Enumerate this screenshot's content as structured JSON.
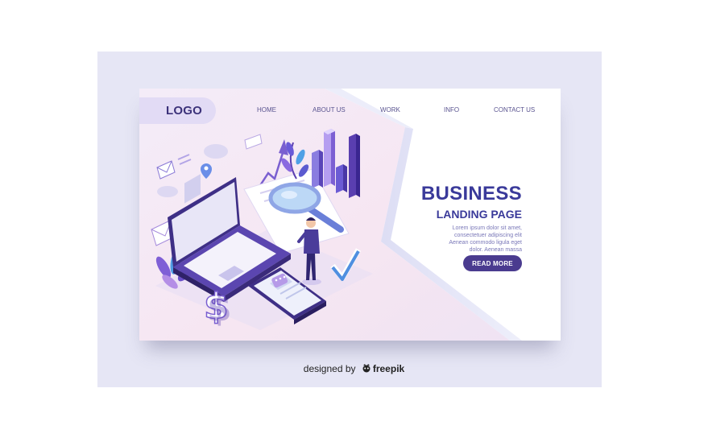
{
  "nav": {
    "logo": "LOGO",
    "items": [
      "HOME",
      "ABOUT US",
      "WORK",
      "INFO",
      "CONTACT US"
    ]
  },
  "hero": {
    "title": "BUSINESS",
    "subtitle": "LANDING PAGE",
    "body_lines": [
      "Lorem ipsum dolor sit amet,",
      "consectetuer adipiscing elit",
      "Aenean commodo ligula eget",
      "dolor. Aenean massa"
    ],
    "cta_label": "READ MORE"
  },
  "credit": {
    "prefix": "designed by",
    "brand": "freepik",
    "brand_icon": "freepik-logo-icon"
  },
  "colors": {
    "background_frame": "#e6e6f5",
    "primary_text": "#3a3a9a",
    "button": "#4a3b8f",
    "accent_purple": "#7a5fd0",
    "accent_blue": "#5aa0e0"
  }
}
